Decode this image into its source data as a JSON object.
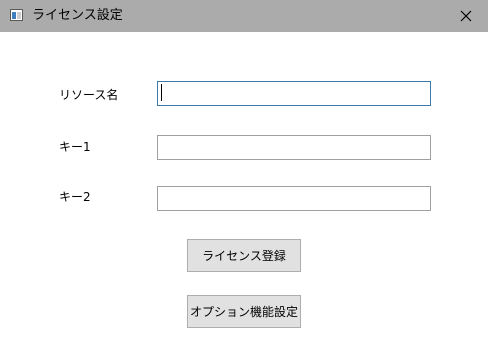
{
  "window": {
    "title": "ライセンス設定",
    "icon": "window-app-icon",
    "close_icon": "close-icon"
  },
  "form": {
    "resource_name": {
      "label": "リソース名",
      "value": "",
      "placeholder": ""
    },
    "key1": {
      "label": "キー1",
      "value": "",
      "placeholder": ""
    },
    "key2": {
      "label": "キー2",
      "value": "",
      "placeholder": ""
    }
  },
  "buttons": {
    "register_label": "ライセンス登録",
    "options_label": "オプション機能設定"
  },
  "colors": {
    "titlebar": "#ababab",
    "focus_border": "#3d7bad",
    "button_face": "#e1e1e1"
  }
}
